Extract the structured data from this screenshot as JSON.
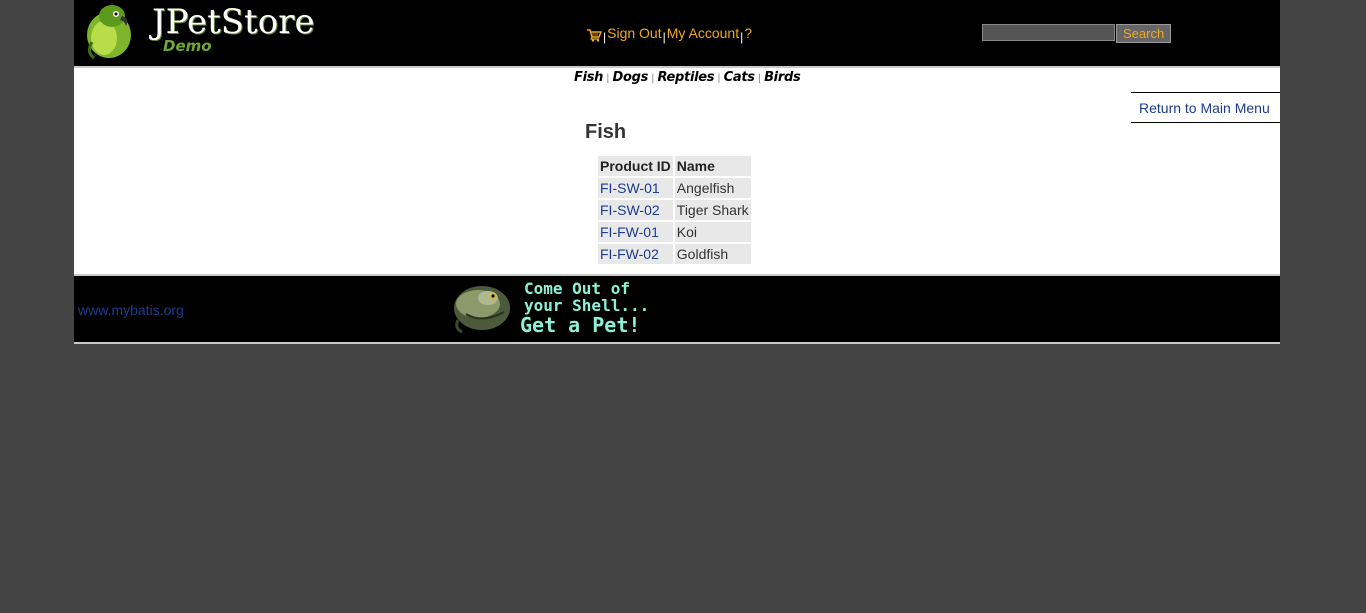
{
  "header": {
    "logo_text": "JPetStore",
    "logo_subtext": "Demo",
    "menu": {
      "sign_out": "Sign Out",
      "my_account": "My Account",
      "help": "?",
      "separator": "|"
    },
    "search": {
      "value": "",
      "button_label": "Search"
    }
  },
  "quicklinks": [
    {
      "label": "Fish"
    },
    {
      "label": "Dogs"
    },
    {
      "label": "Reptiles"
    },
    {
      "label": "Cats"
    },
    {
      "label": "Birds"
    }
  ],
  "content": {
    "back_link": "Return to Main Menu",
    "title": "Fish",
    "table": {
      "headers": [
        "Product ID",
        "Name"
      ],
      "rows": [
        {
          "id": "FI-SW-01",
          "name": "Angelfish"
        },
        {
          "id": "FI-SW-02",
          "name": "Tiger Shark"
        },
        {
          "id": "FI-FW-01",
          "name": "Koi"
        },
        {
          "id": "FI-FW-02",
          "name": "Goldfish"
        }
      ]
    }
  },
  "footer": {
    "link": "www.mybatis.org",
    "banner_line1": "Come Out of",
    "banner_line2": "your Shell...",
    "banner_line3": "Get a Pet!"
  },
  "colors": {
    "page_background": "#444444",
    "header_background": "#000000",
    "menu_link": "#f2a81b",
    "link_blue": "#1c3c8c",
    "table_cell": "#e8e8e8"
  },
  "icons": {
    "cart": "cart-icon",
    "parrot_logo": "parrot-logo-icon",
    "lizard_banner": "lizard-icon"
  }
}
